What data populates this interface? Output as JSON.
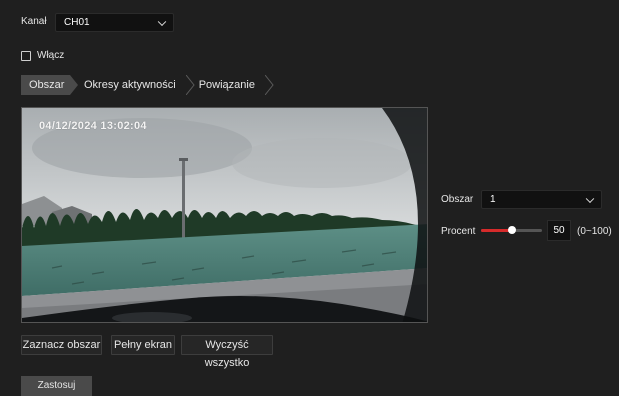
{
  "channel": {
    "label": "Kanał",
    "value": "CH01"
  },
  "enable": {
    "label": "Włącz",
    "checked": false
  },
  "tabs": [
    {
      "label": "Obszar",
      "active": true
    },
    {
      "label": "Okresy aktywności",
      "active": false
    },
    {
      "label": "Powiązanie",
      "active": false
    }
  ],
  "video": {
    "osd_text": "04/12/2024  13:02:04"
  },
  "side": {
    "area_label": "Obszar",
    "area_value": "1",
    "percent_label": "Procent",
    "percent_value": "50",
    "percent_range": "(0~100)",
    "percent_level": 50
  },
  "buttons": {
    "mark_area": "Zaznacz obszar",
    "fullscreen": "Pełny ekran",
    "clear_all": "Wyczyść wszystko",
    "apply": "Zastosuj"
  },
  "colors": {
    "accent": "#d62b2b",
    "background": "#1f1f1f",
    "active_tab": "#4a4a4a"
  }
}
